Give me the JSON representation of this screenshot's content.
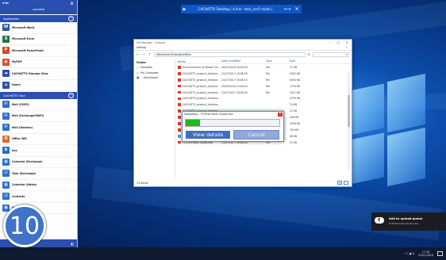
{
  "colors": {
    "accent": "#2a4fb0",
    "topbar": "#0e58c6",
    "progress": "#23b623",
    "toast_bg": "#1b1d22",
    "taskbar": "#0d1a30"
  },
  "topbar": {
    "title": "CACHATTO Desktop  [ 4 link - tech_ver5 mode ]",
    "play_icon": "▶",
    "swap_icon": "⟷",
    "close_icon": "✕"
  },
  "panel": {
    "brand": "e-tic",
    "user": "cachatto",
    "sections": {
      "application": "Application",
      "tool": "CACHATTO Tool"
    },
    "apps": [
      {
        "label": "Microsoft Word",
        "icon": "W",
        "color": "#2b579a"
      },
      {
        "label": "Microsoft Excel",
        "icon": "X",
        "color": "#217346"
      },
      {
        "label": "Microsoft PowerPoint",
        "icon": "P",
        "color": "#d24726"
      },
      {
        "label": "MyPDF",
        "icon": "◉",
        "color": "#e04a2f"
      },
      {
        "label": "CACHATTO Storage View",
        "icon": "☁",
        "color": "#2a4fb0"
      },
      {
        "label": "Home",
        "icon": "⌂",
        "color": "#2a4fb0"
      }
    ],
    "tools": [
      {
        "label": "Mail (POP3)",
        "icon": "✉",
        "color": "#2a6fc9"
      },
      {
        "label": "Mail (Exchange/MAPI)",
        "icon": "✉",
        "color": "#2a6fc9"
      },
      {
        "label": "Mail (Domino)",
        "icon": "✉",
        "color": "#2a6fc9"
      },
      {
        "label": "Office 365",
        "icon": "O",
        "color": "#e0672d"
      },
      {
        "label": "box",
        "icon": "b",
        "color": "#2a6fc9"
      },
      {
        "label": "Calendar (Exchange)",
        "icon": "▦",
        "color": "#2a6fc9"
      },
      {
        "label": "Task (Exchange)",
        "icon": "☑",
        "color": "#2a6fc9"
      },
      {
        "label": "Calendar (Notes)",
        "icon": "▦",
        "color": "#2a6fc9"
      },
      {
        "label": "Contacts",
        "icon": "☺",
        "color": "#2a6fc9"
      },
      {
        "label": "Portal",
        "icon": "▣",
        "color": "#2a6fc9"
      }
    ]
  },
  "badge": {
    "number": "10"
  },
  "explorer": {
    "title": "File Manager - Intranet",
    "ribbon": "Setting",
    "path": "\\\\fileserver\\01\\english\\files",
    "nav_header": "Folder",
    "nav_items": [
      {
        "label": "Favorites",
        "icon": "★"
      },
      {
        "label": "My Computer",
        "icon": "▭"
      },
      {
        "label": "…\\Quickwork",
        "icon": "■"
      }
    ],
    "columns": {
      "name": "Name",
      "date": "Date modified",
      "type": "Type",
      "size": "Size"
    },
    "rows": [
      {
        "name": "Announcement at Master Ge…",
        "date": "26/01/2018 18:04:50",
        "type": "File",
        "size": "27 KB",
        "icon": "file"
      },
      {
        "name": "CACHATTO_product_introduc…",
        "date": "21/07/2017 16:08:05",
        "type": "File",
        "size": "2402 KB",
        "icon": "file"
      },
      {
        "name": "CACHATTO_product_introduc…",
        "date": "21/07/2017 16:08:15",
        "type": "File",
        "size": "6454 KB",
        "icon": "file"
      },
      {
        "name": "CACHATTO_product_introduc…",
        "date": "05/09/2016 14:04:20",
        "type": "File",
        "size": "1276 KB",
        "icon": "file"
      },
      {
        "name": "CACHATTO_product_introduc…",
        "date": "21/07/2017 16:08:24",
        "type": "File",
        "size": "3471 KB",
        "icon": "file"
      },
      {
        "name": "CACHATTO_product_introduc…",
        "date": "",
        "type": "",
        "size": "4735 KB",
        "icon": "file"
      },
      {
        "name": "CACHATTO_product_introduc…",
        "date": "",
        "type": "",
        "size": "74 KB",
        "icon": "file"
      },
      {
        "name": "CACHATTO_product_introduc…",
        "date": "",
        "type": "",
        "size": "12 KB",
        "icon": "file"
      },
      {
        "name": "CACHATTO_product_introduc…",
        "date": "",
        "type": "",
        "size": "206 KB",
        "icon": "file"
      },
      {
        "name": "Resources_CACHATTO_users_i…",
        "date": "16/02/2018 13:06:40",
        "type": "File",
        "size": "2036 KB",
        "icon": "file"
      },
      {
        "name": "Sales meeting_CCN Sent.pdf",
        "date": "16/09/2017 14:06:41",
        "type": "File",
        "size": "104 KB",
        "icon": "file"
      },
      {
        "name": "spinning_wheel.png",
        "date": "15/09/2017 08:01:23",
        "type": "Image File",
        "size": "46 KB",
        "icon": "img"
      },
      {
        "name": "FY2018 Sales Quota.xlsx",
        "date": "21/07/2017 16:08:24",
        "type": "File",
        "size": "22 KB",
        "icon": "file"
      }
    ],
    "status": "13 items"
  },
  "upload": {
    "title": "Uploading... FY2018 Sales Quota.xlsx",
    "close_icon": "✕",
    "progress": 0.15,
    "view_label": "View details",
    "cancel_label": "Cancel"
  },
  "toast": {
    "title": "Add to upload queue",
    "subtitle": "FY2018 Sales Quota.xlsx"
  },
  "taskbar": {
    "tray_icons": "↑⇡ ● A",
    "time": "17:26",
    "date": "22/01/2018"
  }
}
